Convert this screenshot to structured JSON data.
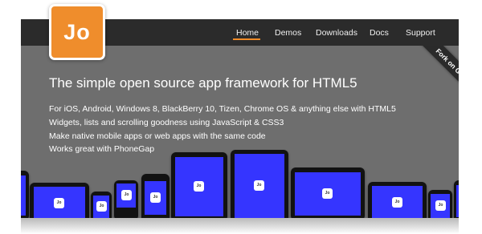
{
  "logo": {
    "text": "Jo"
  },
  "nav": {
    "items": [
      {
        "label": "Home",
        "active": true
      },
      {
        "label": "Demos"
      },
      {
        "label": "Downloads"
      },
      {
        "label": "Docs"
      },
      {
        "label": "Support"
      }
    ]
  },
  "ribbon": {
    "label": "Fork on GitHub"
  },
  "hero": {
    "headline": "The simple open source app framework for HTML5",
    "features": [
      "For iOS, Android, Windows 8, BlackBerry 10, Tizen, Chrome OS & anything else with HTML5",
      "Widgets, lists and scrolling goodness using JavaScript & CSS3",
      "Make native mobile apps or web apps with the same code",
      "Works great with PhoneGap"
    ]
  },
  "devices": {
    "app_icon_text": "Jo"
  },
  "colors": {
    "brand_orange": "#ef8d2c",
    "screen_blue": "#3535ff",
    "nav_bg": "#2b2b2b",
    "hero_bg": "#6e6e6e"
  }
}
